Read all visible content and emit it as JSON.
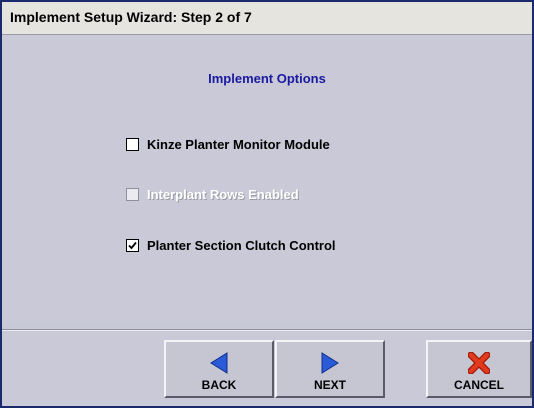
{
  "window": {
    "title": "Implement Setup Wizard:  Step 2 of 7"
  },
  "main": {
    "heading": "Implement Options",
    "options": [
      {
        "label": "Kinze Planter Monitor Module",
        "checked": false,
        "enabled": true
      },
      {
        "label": "Interplant Rows Enabled",
        "checked": false,
        "enabled": false
      },
      {
        "label": "Planter Section Clutch Control",
        "checked": true,
        "enabled": true
      }
    ]
  },
  "footer": {
    "back_label": "BACK",
    "next_label": "NEXT",
    "cancel_label": "CANCEL"
  },
  "colors": {
    "window_border": "#1a2a6c",
    "heading": "#1a1aa0",
    "arrow_blue": "#2a5ad8",
    "cancel_red": "#e23a1c"
  },
  "icons": {
    "back": "left-arrow-icon",
    "next": "right-arrow-icon",
    "cancel": "red-x-icon"
  }
}
